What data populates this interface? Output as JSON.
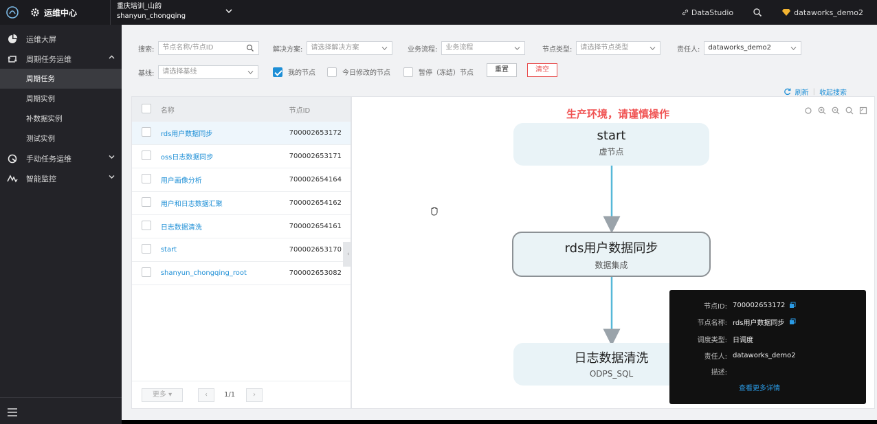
{
  "header": {
    "app_title": "运维中心",
    "workspace_line1": "重庆培训_山韵",
    "workspace_line2": "shanyun_chongqing",
    "links": [
      "DataStudio"
    ],
    "user": "dataworks_demo2"
  },
  "sidebar": {
    "items": [
      {
        "label": "运维大屏",
        "icon": "dashboard-icon"
      },
      {
        "label": "周期任务运维",
        "icon": "cycle-icon",
        "expanded": true
      },
      {
        "label": "周期任务",
        "sub": true,
        "active": true
      },
      {
        "label": "周期实例",
        "sub": true
      },
      {
        "label": "补数据实例",
        "sub": true
      },
      {
        "label": "测试实例",
        "sub": true
      },
      {
        "label": "手动任务运维",
        "icon": "manual-icon"
      },
      {
        "label": "智能监控",
        "icon": "monitor-icon"
      }
    ]
  },
  "filters": {
    "search_label": "搜索:",
    "search_placeholder": "节点名称/节点ID",
    "solution_label": "解决方案:",
    "solution_placeholder": "请选择解决方案",
    "flow_label": "业务流程:",
    "flow_placeholder": "业务流程",
    "type_label": "节点类型:",
    "type_placeholder": "请选择节点类型",
    "owner_label": "责任人:",
    "owner_value": "dataworks_demo2",
    "baseline_label": "基线:",
    "baseline_placeholder": "请选择基线",
    "my_nodes": "我的节点",
    "today_modified": "今日修改的节点",
    "paused": "暂停（冻结）节点",
    "reset": "重置",
    "clear": "清空",
    "refresh": "刷新",
    "collapse_search": "收起搜索"
  },
  "table": {
    "headers": {
      "name": "名称",
      "id": "节点ID"
    },
    "rows": [
      {
        "name": "rds用户数据同步",
        "id": "700002653172",
        "selected": true
      },
      {
        "name": "oss日志数据同步",
        "id": "700002653171"
      },
      {
        "name": "用户画像分析",
        "id": "700002654164"
      },
      {
        "name": "用户和日志数据汇聚",
        "id": "700002654162"
      },
      {
        "name": "日志数据清洗",
        "id": "700002654161"
      },
      {
        "name": "start",
        "id": "700002653170"
      },
      {
        "name": "shanyun_chongqing_root",
        "id": "700002653082"
      }
    ],
    "pager": {
      "more": "更多",
      "page": "1/1"
    }
  },
  "graph": {
    "warning": "生产环境，请谨慎操作",
    "nodes": [
      {
        "title": "start",
        "subtitle": "虚节点"
      },
      {
        "title": "rds用户数据同步",
        "subtitle": "数据集成"
      },
      {
        "title": "日志数据清洗",
        "subtitle": "ODPS_SQL"
      }
    ]
  },
  "popover": {
    "rows": [
      {
        "k": "节点ID:",
        "v": "700002653172",
        "copy": true
      },
      {
        "k": "节点名称:",
        "v": "rds用户数据同步",
        "copy": true
      },
      {
        "k": "调度类型:",
        "v": "日调度"
      },
      {
        "k": "责任人:",
        "v": "dataworks_demo2"
      },
      {
        "k": "描述:",
        "v": ""
      }
    ],
    "more": "查看更多详情"
  },
  "colors": {
    "accent": "#1e8fd6",
    "warning": "#f05454",
    "sidebar": "#232328"
  }
}
